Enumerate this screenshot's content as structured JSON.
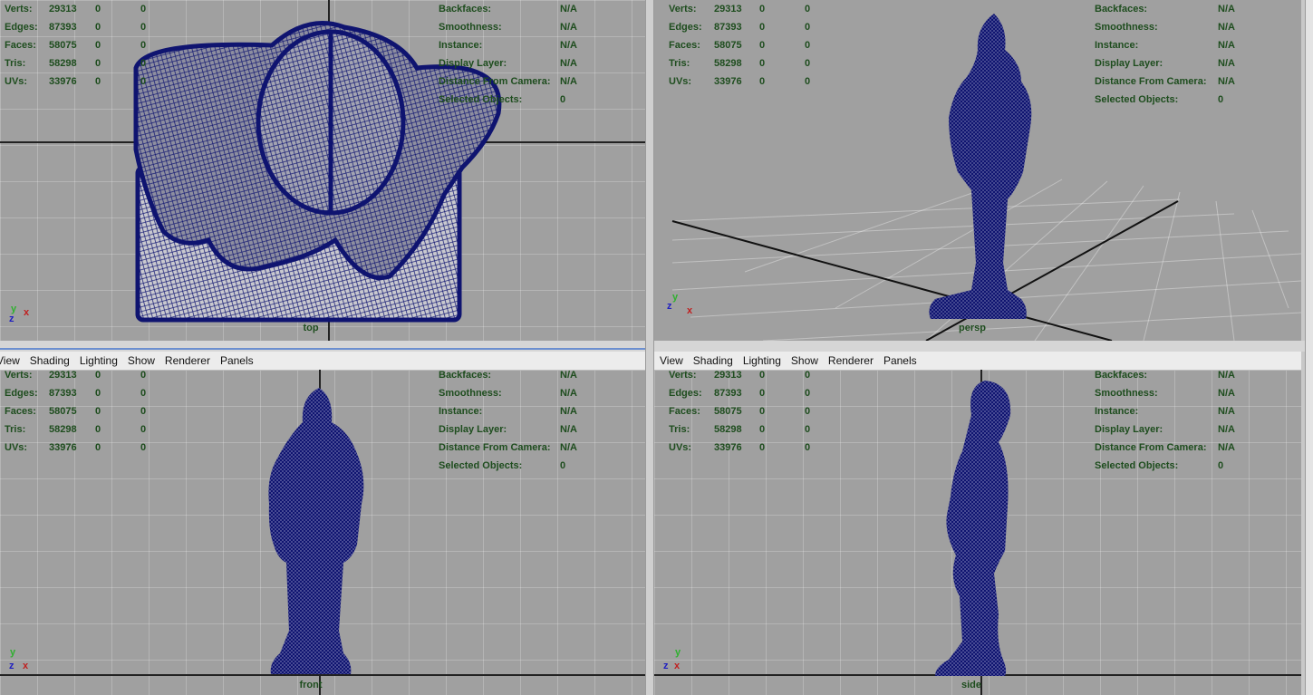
{
  "menu": {
    "view": "View",
    "shading": "Shading",
    "lighting": "Lighting",
    "show": "Show",
    "renderer": "Renderer",
    "panels": "Panels"
  },
  "hud": {
    "verts_label": "Verts:",
    "edges_label": "Edges:",
    "faces_label": "Faces:",
    "tris_label": "Tris:",
    "uvs_label": "UVs:",
    "verts": "29313",
    "edges": "87393",
    "faces": "58075",
    "tris": "58298",
    "uvs": "33976",
    "zero": "0",
    "backfaces_label": "Backfaces:",
    "smoothness_label": "Smoothness:",
    "instance_label": "Instance:",
    "display_layer_label": "Display Layer:",
    "distance_label": "Distance From Camera:",
    "selected_label": "Selected Objects:",
    "na": "N/A",
    "selected_value": "0"
  },
  "viewports": {
    "top": "top",
    "persp": "persp",
    "front": "front",
    "side": "side"
  },
  "axes": {
    "x": "x",
    "y": "y",
    "z": "z"
  },
  "colors": {
    "viewport_bg": "#a0a0a0",
    "hud_text": "#1e4d1e",
    "wireframe": "#0f1470"
  }
}
